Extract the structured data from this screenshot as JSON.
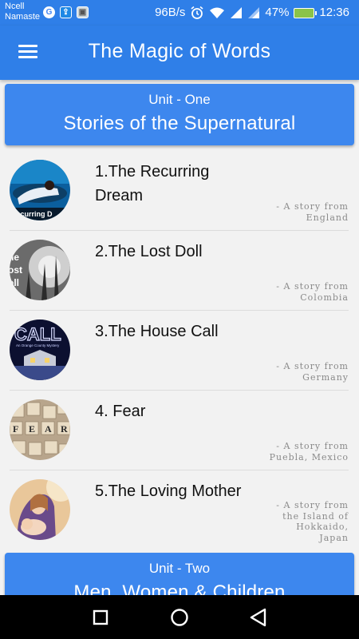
{
  "status_bar": {
    "carrier_line1": "Ncell",
    "carrier_line2": "Namaste",
    "network_speed": "96B/s",
    "battery": "47%",
    "time": "12:36"
  },
  "app_bar": {
    "title": "The Magic of Words"
  },
  "units": [
    {
      "label": "Unit - One",
      "title": "Stories of the Supernatural"
    },
    {
      "label": "Unit - Two",
      "title": "Men, Women & Children"
    }
  ],
  "stories": [
    {
      "title": "1.The Recurring Dream",
      "origin_line1": "- A story from",
      "origin_line2": "England"
    },
    {
      "title": "2.The Lost Doll",
      "origin_line1": "- A story from",
      "origin_line2": "Colombia"
    },
    {
      "title": "3.The House Call",
      "origin_line1": "- A story from",
      "origin_line2": "Germany"
    },
    {
      "title": "4. Fear",
      "origin_line1": "- A story from",
      "origin_line2": "Puebla, Mexico"
    },
    {
      "title": "5.The Loving Mother",
      "origin_line1": "- A story from",
      "origin_line2": "the Island of",
      "origin_line3": "Hokkaido,",
      "origin_line4": "Japan"
    }
  ],
  "thumbnail_text": {
    "story1": "Recurring D",
    "story2_a": "he",
    "story2_b": "ost",
    "story2_c": "oll",
    "story3_a": "CALL",
    "story3_b": "An Orange County Mystery",
    "story4_letters": [
      "F",
      "E",
      "A",
      "R"
    ]
  },
  "colors": {
    "primary": "#2f7fe8",
    "unit_card": "#3d87ee",
    "background": "#f2f2f2"
  },
  "icons": {
    "menu": "menu-icon",
    "alarm": "alarm-icon",
    "wifi": "wifi-icon",
    "signal": "signal-icon",
    "battery": "battery-icon",
    "nav_recent": "square-icon",
    "nav_home": "circle-icon",
    "nav_back": "triangle-back-icon"
  }
}
